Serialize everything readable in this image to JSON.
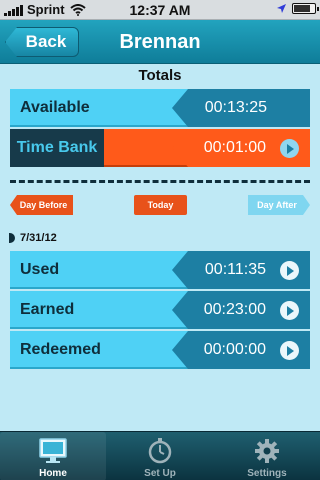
{
  "status_bar": {
    "carrier": "Sprint",
    "time": "12:37 AM",
    "battery_level": 0.8,
    "icons": [
      "signal-icon",
      "wifi-icon",
      "location-icon",
      "battery-icon"
    ]
  },
  "nav": {
    "back_label": "Back",
    "title": "Brennan"
  },
  "totals": {
    "heading": "Totals",
    "available": {
      "label": "Available",
      "value": "00:13:25"
    },
    "time_bank": {
      "label": "Time Bank",
      "value": "00:01:00"
    }
  },
  "day_nav": {
    "before_label": "Day Before",
    "today_label": "Today",
    "after_label": "Day After"
  },
  "date": "7/31/12",
  "entries": [
    {
      "label": "Used",
      "value": "00:11:35"
    },
    {
      "label": "Earned",
      "value": "00:23:00"
    },
    {
      "label": "Redeemed",
      "value": "00:00:00"
    }
  ],
  "tabs": [
    {
      "label": "Home",
      "icon": "monitor-icon",
      "active": true
    },
    {
      "label": "Set Up",
      "icon": "stopwatch-icon",
      "active": false
    },
    {
      "label": "Settings",
      "icon": "gear-icon",
      "active": false
    }
  ],
  "colors": {
    "background": "#bfe9f5",
    "nav": "#1686a5",
    "row": "#4fd1f5",
    "value_panel": "#1d7fa3",
    "accent_orange": "#ff5a1a",
    "dark_label": "#173a4a"
  }
}
